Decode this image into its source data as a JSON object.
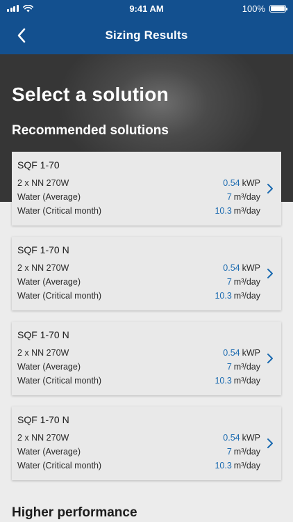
{
  "status_bar": {
    "time": "9:41 AM",
    "battery": "100%",
    "battery_level": 1.0
  },
  "nav": {
    "title": "Sizing Results"
  },
  "page": {
    "title": "Select a solution",
    "recommended_heading": "Recommended solutions",
    "higher_heading": "Higher performance"
  },
  "solutions": [
    {
      "name": "SQF 1-70",
      "panel_label": "2 x NN 270W",
      "power_value": "0.54",
      "power_unit": "kWP",
      "avg_label": "Water (Average)",
      "avg_value": "7",
      "avg_unit": "m³/day",
      "crit_label": "Water (Critical month)",
      "crit_value": "10.3",
      "crit_unit": "m³/day"
    },
    {
      "name": "SQF 1-70 N",
      "panel_label": "2 x NN 270W",
      "power_value": "0.54",
      "power_unit": "kWP",
      "avg_label": "Water (Average)",
      "avg_value": "7",
      "avg_unit": "m³/day",
      "crit_label": "Water (Critical month)",
      "crit_value": "10.3",
      "crit_unit": "m³/day"
    },
    {
      "name": "SQF 1-70 N",
      "panel_label": "2 x NN 270W",
      "power_value": "0.54",
      "power_unit": "kWP",
      "avg_label": "Water (Average)",
      "avg_value": "7",
      "avg_unit": "m³/day",
      "crit_label": "Water (Critical month)",
      "crit_value": "10.3",
      "crit_unit": "m³/day"
    },
    {
      "name": "SQF 1-70 N",
      "panel_label": "2 x NN 270W",
      "power_value": "0.54",
      "power_unit": "kWP",
      "avg_label": "Water (Average)",
      "avg_value": "7",
      "avg_unit": "m³/day",
      "crit_label": "Water (Critical month)",
      "crit_value": "10.3",
      "crit_unit": "m³/day"
    }
  ],
  "icons": {
    "back": "chevron-left-icon",
    "row_arrow": "chevron-right-icon",
    "signal": "signal-icon",
    "wifi": "wifi-icon",
    "battery": "battery-icon"
  },
  "colors": {
    "nav_bg": "#13508f",
    "hero_bg": "#3a3a3a",
    "value_blue": "#1c6bb0",
    "card_bg": "#e9e9e9",
    "page_bg": "#ececec"
  }
}
